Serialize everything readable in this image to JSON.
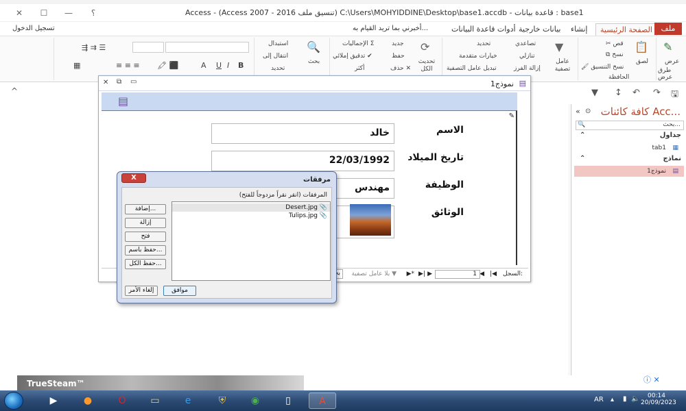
{
  "app": {
    "title": "Access - (Access 2007 - 2016 تنسيق ملف) C:\\Users\\MOHYIDDINE\\Desktop\\base1.accdb - قاعدة بيانات : base1",
    "minimize": "—",
    "restore": "☐",
    "close": "✕",
    "help": "؟"
  },
  "menu": {
    "file": "ملف",
    "home": "الصفحة الرئيسية",
    "create": "إنشاء",
    "external": "بيانات خارجية",
    "dbtools": "أدوات قاعدة البيانات",
    "tellme": "أخبرني بما تريد القيام به...",
    "signin": "تسجيل الدخول"
  },
  "ribbon": {
    "view": "عرض",
    "views_group": "طرق عرض",
    "paste": "لصق",
    "cut": "قص",
    "copy": "نسخ",
    "format_painter": "نسخ التنسيق",
    "clipboard_group": "الحافظة",
    "filter": "عامل تصفية",
    "ascending": "تصاعدي",
    "descending": "تنازلي",
    "remove_sort": "إزالة الفرز",
    "selection": "تحديد",
    "advanced": "خيارات متقدمة",
    "toggle_filter": "تبديل عامل التصفية",
    "refresh": "تحديث الكل",
    "new": "جديد",
    "save": "حفظ",
    "delete": "حذف",
    "totals": "الإجماليات",
    "spelling": "تدقيق إملائي",
    "more": "أكثر",
    "find": "بحث",
    "replace": "استبدال",
    "goto": "انتقال إلى",
    "select": "تحديد"
  },
  "nav": {
    "title": "كافة كائنات Acc...",
    "search": "بحث...",
    "tables_section": "جداول",
    "table1": "tab1",
    "forms_section": "نماذج",
    "form1": "نموذج1"
  },
  "form": {
    "window_title": "نموذج1",
    "fields": [
      {
        "label": "الاسم",
        "value": "خالد"
      },
      {
        "label": "تاريخ الميلاد",
        "value": "22/03/1992"
      },
      {
        "label": "الوظيفة",
        "value": "مهندس"
      },
      {
        "label": "الوثائق",
        "value": ""
      }
    ],
    "recnav": {
      "record_label": "السجل:",
      "current": "1",
      "filter_status": "بلا عامل تصفية",
      "search": "بحث"
    }
  },
  "dialog": {
    "title": "مرفقات",
    "close": "X",
    "caption": "المرفقات (انقر نقراً مزدوجاً للفتح)",
    "files": [
      "Desert.jpg",
      "Tulips.jpg"
    ],
    "add": "إضافة...",
    "remove": "إزالة",
    "open": "فتح",
    "save_as": "حفظ باسم...",
    "save_all": "حفظ الكل...",
    "ok": "موافق",
    "cancel": "إلغاء الأمر"
  },
  "ad": {
    "text": "TrueSteam™"
  },
  "tray": {
    "lang": "AR",
    "time": "00:14",
    "date": "20/09/2023"
  }
}
